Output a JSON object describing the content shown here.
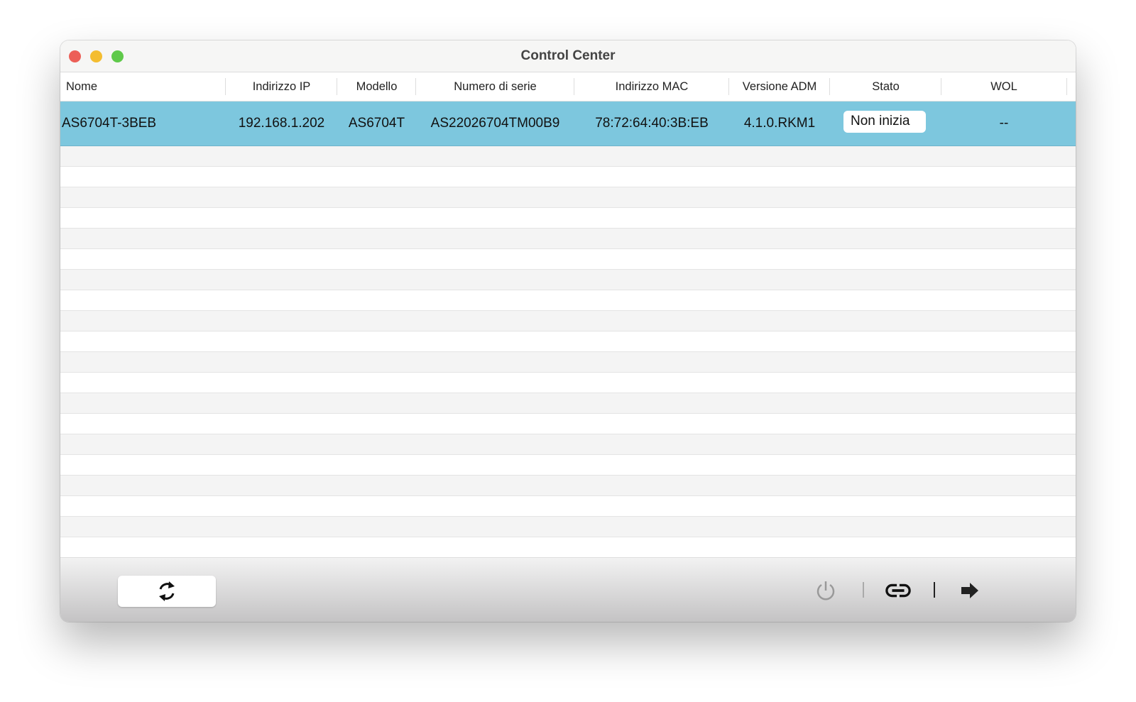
{
  "window": {
    "title": "Control Center"
  },
  "table": {
    "columns": [
      "Nome",
      "Indirizzo IP",
      "Modello",
      "Numero di serie",
      "Indirizzo MAC",
      "Versione ADM",
      "Stato",
      "WOL"
    ],
    "rows": [
      {
        "name": "AS6704T-3BEB",
        "ip": "192.168.1.202",
        "model": "AS6704T",
        "serial": "AS22026704TM00B9",
        "mac": "78:72:64:40:3B:EB",
        "adm": "4.1.0.RKM1",
        "status": "Non inizia",
        "wol": "--"
      }
    ]
  },
  "toolbar": {
    "icons": [
      "refresh-icon",
      "power-icon",
      "link-icon",
      "arrow-right-icon"
    ]
  },
  "colors": {
    "selection": "#7dc7de",
    "close": "#ec5f57",
    "minimize": "#f4bd30",
    "zoom": "#5fc94a"
  }
}
